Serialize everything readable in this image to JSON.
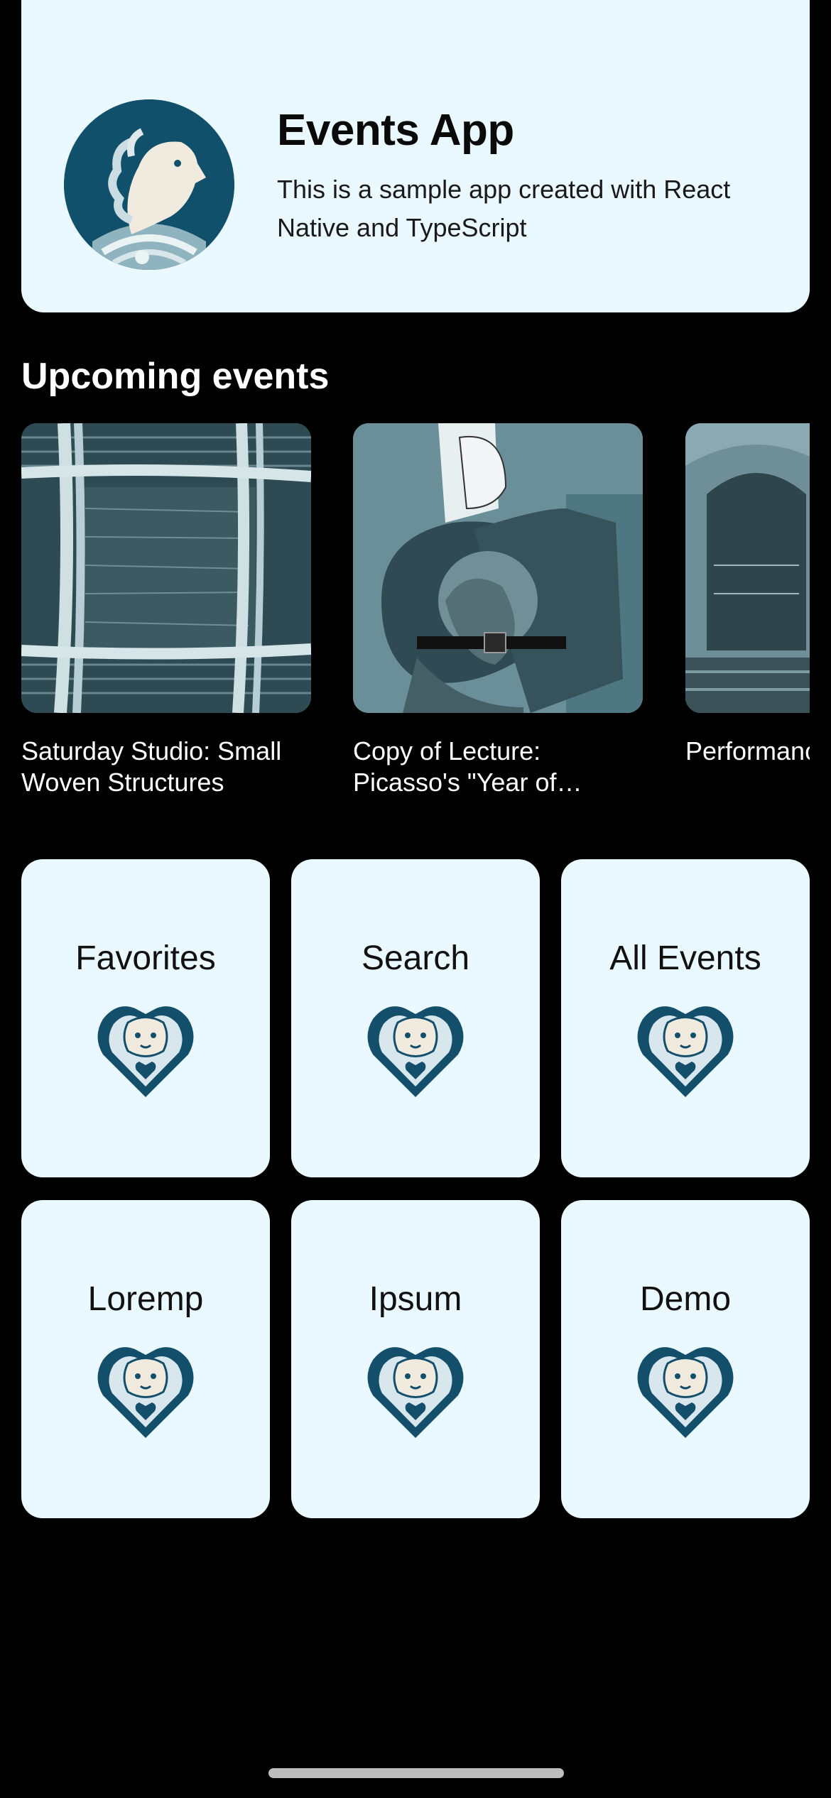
{
  "header": {
    "title": "Events App",
    "subtitle": "This is a sample app created with React Native and TypeScript",
    "logo_icon": "lion-logo-icon"
  },
  "upcoming": {
    "section_title": "Upcoming events",
    "events": [
      {
        "title": "Saturday Studio: Small Woven Structures",
        "image_icon": "woven-textile-image"
      },
      {
        "title": "Copy of Lecture: Picasso's \"Year of Wonders\"",
        "image_icon": "picasso-painting-image"
      },
      {
        "title": "Performance: Turato—po",
        "image_icon": "theater-hall-image"
      }
    ]
  },
  "menu": {
    "tiles": [
      {
        "label": "Favorites",
        "icon": "lion-heart-icon"
      },
      {
        "label": "Search",
        "icon": "lion-heart-icon"
      },
      {
        "label": "All Events",
        "icon": "lion-heart-icon"
      },
      {
        "label": "Loremp",
        "icon": "lion-heart-icon"
      },
      {
        "label": "Ipsum",
        "icon": "lion-heart-icon"
      },
      {
        "label": "Demo",
        "icon": "lion-heart-icon"
      }
    ]
  },
  "colors": {
    "background": "#000000",
    "card": "#eaf8ff",
    "brand_teal": "#11506a"
  }
}
